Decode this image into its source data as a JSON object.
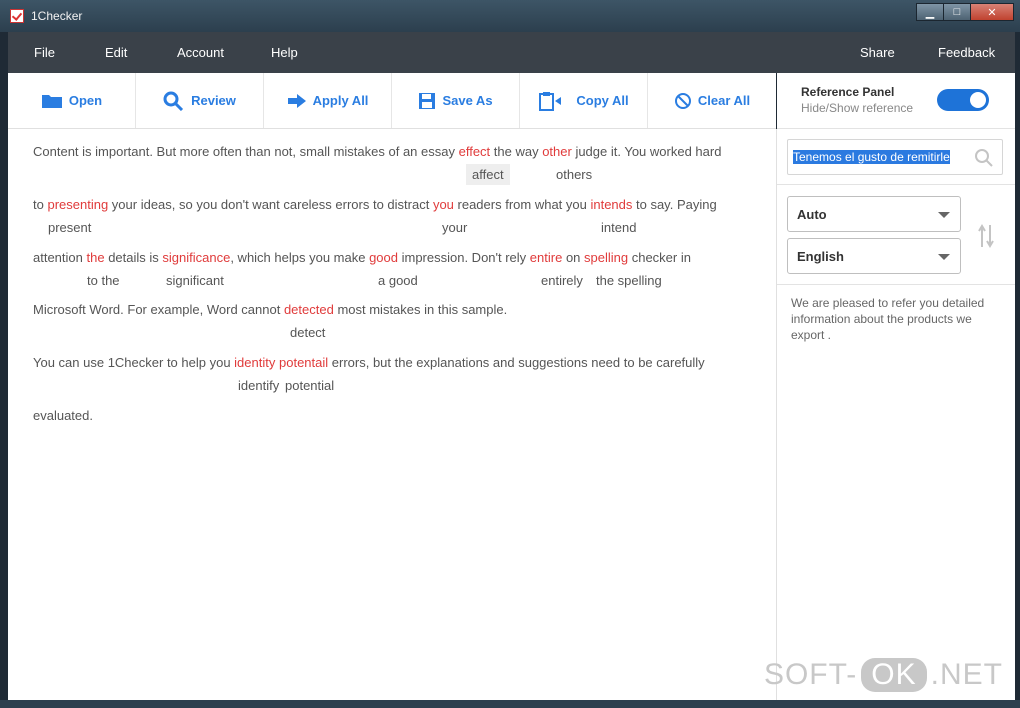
{
  "window": {
    "title": "1Checker",
    "controls": {
      "minimize": "▁",
      "maximize": "□",
      "close": "✕"
    }
  },
  "menu": {
    "items": [
      "File",
      "Edit",
      "Account",
      "Help"
    ],
    "right_items": [
      "Share",
      "Feedback"
    ]
  },
  "toolbar": {
    "buttons": [
      {
        "label": "Open",
        "icon": "folder-icon"
      },
      {
        "label": "Review",
        "icon": "magnifier-icon"
      },
      {
        "label": "Apply All",
        "icon": "arrow-right-icon"
      },
      {
        "label": "Save As",
        "icon": "floppy-disk-icon"
      },
      {
        "label": "Copy All",
        "icon": "clipboard-icon"
      },
      {
        "label": "Clear All",
        "icon": "prohibited-icon"
      }
    ]
  },
  "editor": {
    "lines": [
      [
        "Content is important. But more often than not, small mistakes of an essay ",
        "effect",
        " the way ",
        "other",
        " judge it. You worked hard"
      ],
      [
        "to ",
        "presenting",
        " your ideas, so you don't want careless errors to distract ",
        "you",
        " readers from what you ",
        "intends",
        " to say. Paying"
      ],
      [
        "attention ",
        "the",
        " details is ",
        "significance",
        ", which helps you make ",
        "good",
        " impression. Don't rely ",
        "entire",
        " on ",
        "spelling",
        " checker in"
      ],
      [
        "Microsoft Word. For example, Word cannot ",
        "detected",
        " most mistakes in this sample."
      ],
      [
        "You can use 1Checker to help you ",
        "identity",
        " ",
        "potentail",
        " errors, but the explanations and suggestions need to be carefully"
      ],
      [
        "evaluated."
      ]
    ],
    "suggestions": {
      "affect": "affect",
      "others": "others",
      "present": "present",
      "your": "your",
      "intend": "intend",
      "to_the": "to the",
      "significant": "significant",
      "a_good": "a good",
      "entirely": "entirely",
      "the_spelling": "the spelling",
      "detect": "detect",
      "identify": "identify",
      "potential": "potential"
    }
  },
  "reference_panel": {
    "title": "Reference Panel",
    "subtitle": "Hide/Show reference",
    "toggle_on": true,
    "search_value": "Tenemos el gusto de remitirle",
    "source_lang": "Auto",
    "target_lang": "English",
    "translation": "We are pleased to refer you detailed information about the products we export ."
  },
  "watermark": {
    "left": "SOFT-",
    "mid": "OK",
    "right": ".NET"
  },
  "colors": {
    "accent": "#2a7de1",
    "error": "#e03b3b",
    "menubar": "#3a4149",
    "toggle": "#1e73d8"
  }
}
